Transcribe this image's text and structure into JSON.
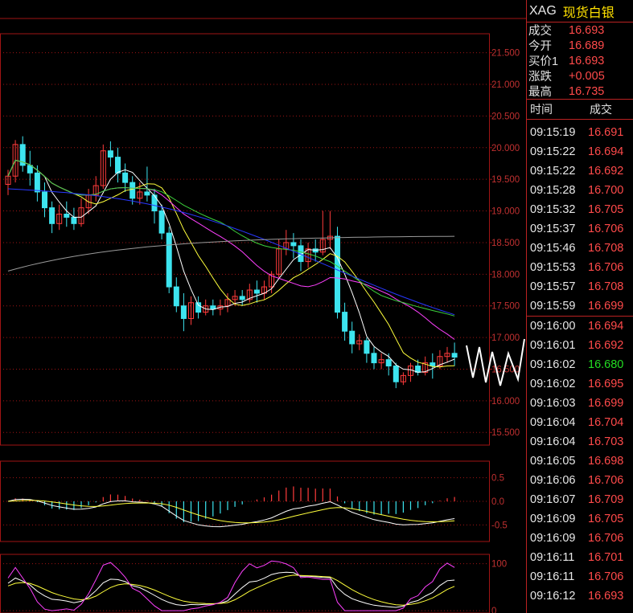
{
  "header": {
    "code": "XAG",
    "name": "现货白银"
  },
  "quote": [
    {
      "label": "成交",
      "value": "16.693"
    },
    {
      "label": "今开",
      "value": "16.689"
    },
    {
      "label": "买价1",
      "value": "16.693"
    },
    {
      "label": "涨跌",
      "value": "+0.005"
    },
    {
      "label": "最高",
      "value": "16.735"
    }
  ],
  "ticks_header": {
    "time": "时间",
    "price": "成交"
  },
  "ticks": [
    {
      "time": "09:15:19",
      "price": "16.691",
      "dir": "up"
    },
    {
      "time": "09:15:22",
      "price": "16.694",
      "dir": "up"
    },
    {
      "time": "09:15:22",
      "price": "16.692",
      "dir": "up"
    },
    {
      "time": "09:15:28",
      "price": "16.700",
      "dir": "up"
    },
    {
      "time": "09:15:32",
      "price": "16.705",
      "dir": "up"
    },
    {
      "time": "09:15:37",
      "price": "16.706",
      "dir": "up"
    },
    {
      "time": "09:15:46",
      "price": "16.708",
      "dir": "up"
    },
    {
      "time": "09:15:53",
      "price": "16.706",
      "dir": "up"
    },
    {
      "time": "09:15:57",
      "price": "16.708",
      "dir": "up"
    },
    {
      "time": "09:15:59",
      "price": "16.699",
      "dir": "up"
    },
    {
      "time": "09:16:00",
      "price": "16.694",
      "dir": "up"
    },
    {
      "time": "09:16:01",
      "price": "16.692",
      "dir": "up"
    },
    {
      "time": "09:16:02",
      "price": "16.680",
      "dir": "down"
    },
    {
      "time": "09:16:02",
      "price": "16.695",
      "dir": "up"
    },
    {
      "time": "09:16:03",
      "price": "16.699",
      "dir": "up"
    },
    {
      "time": "09:16:04",
      "price": "16.704",
      "dir": "up"
    },
    {
      "time": "09:16:04",
      "price": "16.703",
      "dir": "up"
    },
    {
      "time": "09:16:05",
      "price": "16.698",
      "dir": "up"
    },
    {
      "time": "09:16:06",
      "price": "16.706",
      "dir": "up"
    },
    {
      "time": "09:16:07",
      "price": "16.709",
      "dir": "up"
    },
    {
      "time": "09:16:09",
      "price": "16.705",
      "dir": "up"
    },
    {
      "time": "09:16:09",
      "price": "16.706",
      "dir": "up"
    },
    {
      "time": "09:16:11",
      "price": "16.701",
      "dir": "up"
    },
    {
      "time": "09:16:11",
      "price": "16.706",
      "dir": "up"
    },
    {
      "time": "09:16:12",
      "price": "16.693",
      "dir": "up"
    }
  ],
  "chart_data": [
    {
      "type": "candlestick",
      "title": "",
      "y_ticks": [
        "21.500",
        "21.000",
        "20.500",
        "20.000",
        "19.500",
        "19.000",
        "18.500",
        "18.000",
        "17.500",
        "17.000",
        "16.500",
        "16.000",
        "15.500"
      ],
      "ylim": [
        15.3,
        21.8
      ],
      "candles": [
        [
          19.42,
          19.55,
          19.25,
          19.65
        ],
        [
          19.55,
          20.05,
          19.45,
          20.12
        ],
        [
          20.05,
          19.72,
          19.62,
          20.18
        ],
        [
          19.72,
          19.6,
          19.4,
          19.95
        ],
        [
          19.6,
          19.3,
          19.15,
          19.72
        ],
        [
          19.3,
          19.05,
          18.9,
          19.45
        ],
        [
          19.05,
          18.8,
          18.65,
          19.15
        ],
        [
          18.8,
          18.95,
          18.7,
          19.1
        ],
        [
          18.95,
          18.9,
          18.75,
          19.15
        ],
        [
          18.9,
          18.8,
          18.7,
          19.05
        ],
        [
          18.8,
          19.05,
          18.75,
          19.2
        ],
        [
          19.05,
          19.25,
          18.95,
          19.35
        ],
        [
          19.25,
          19.4,
          19.15,
          19.55
        ],
        [
          19.4,
          19.95,
          19.35,
          20.05
        ],
        [
          19.95,
          19.85,
          19.7,
          20.1
        ],
        [
          19.85,
          19.6,
          19.45,
          20.0
        ],
        [
          19.6,
          19.45,
          19.3,
          19.75
        ],
        [
          19.45,
          19.2,
          19.1,
          19.55
        ],
        [
          19.2,
          19.3,
          19.1,
          19.45
        ],
        [
          19.3,
          19.25,
          19.15,
          19.7
        ],
        [
          19.25,
          19.0,
          18.8,
          19.35
        ],
        [
          19.0,
          18.65,
          18.55,
          19.1
        ],
        [
          18.65,
          17.8,
          17.7,
          18.75
        ],
        [
          17.8,
          17.5,
          17.4,
          17.95
        ],
        [
          17.5,
          17.3,
          17.1,
          17.7
        ],
        [
          17.3,
          17.55,
          17.2,
          17.65
        ],
        [
          17.55,
          17.4,
          17.3,
          17.65
        ],
        [
          17.4,
          17.5,
          17.35,
          17.6
        ],
        [
          17.5,
          17.45,
          17.35,
          17.6
        ],
        [
          17.45,
          17.5,
          17.35,
          17.6
        ],
        [
          17.5,
          17.6,
          17.4,
          17.7
        ],
        [
          17.6,
          17.65,
          17.5,
          17.75
        ],
        [
          17.65,
          17.6,
          17.5,
          17.75
        ],
        [
          17.6,
          17.75,
          17.55,
          17.85
        ],
        [
          17.75,
          17.7,
          17.55,
          17.9
        ],
        [
          17.7,
          17.8,
          17.6,
          17.9
        ],
        [
          17.8,
          18.0,
          17.7,
          18.05
        ],
        [
          18.0,
          18.4,
          17.95,
          18.55
        ],
        [
          18.4,
          18.5,
          18.3,
          18.7
        ],
        [
          18.5,
          18.45,
          18.25,
          18.65
        ],
        [
          18.45,
          18.2,
          18.05,
          18.55
        ],
        [
          18.2,
          18.4,
          18.1,
          18.5
        ],
        [
          18.4,
          18.35,
          18.2,
          18.55
        ],
        [
          18.35,
          18.55,
          18.3,
          19.0
        ],
        [
          18.55,
          18.6,
          18.4,
          19.0
        ],
        [
          18.6,
          17.4,
          17.3,
          18.75
        ],
        [
          17.4,
          17.1,
          16.95,
          17.55
        ],
        [
          17.1,
          16.9,
          16.75,
          17.25
        ],
        [
          16.9,
          16.95,
          16.8,
          17.05
        ],
        [
          16.95,
          16.75,
          16.6,
          17.0
        ],
        [
          16.75,
          16.6,
          16.5,
          16.85
        ],
        [
          16.6,
          16.65,
          16.5,
          16.75
        ],
        [
          16.65,
          16.55,
          16.4,
          16.75
        ],
        [
          16.55,
          16.3,
          16.2,
          16.6
        ],
        [
          16.3,
          16.4,
          16.25,
          16.45
        ],
        [
          16.4,
          16.55,
          16.3,
          16.6
        ],
        [
          16.55,
          16.45,
          16.4,
          16.65
        ],
        [
          16.45,
          16.6,
          16.4,
          16.7
        ],
        [
          16.6,
          16.55,
          16.35,
          16.75
        ],
        [
          16.55,
          16.7,
          16.5,
          16.8
        ],
        [
          16.7,
          16.75,
          16.6,
          16.85
        ],
        [
          16.75,
          16.69,
          16.55,
          16.92
        ]
      ]
    },
    {
      "type": "bar",
      "title": "",
      "y_ticks": [
        "0.5",
        "0.0",
        "-0.5"
      ],
      "ylim": [
        -0.85,
        0.85
      ]
    },
    {
      "type": "line",
      "title": "",
      "y_ticks": [
        "100",
        "0"
      ],
      "ylim": [
        -5,
        120
      ]
    }
  ],
  "colors": {
    "up": "#ff3b3b",
    "down": "#3de4ef",
    "grid": "#a01414",
    "ma5": "#ffffff",
    "ma10": "#ffff3c",
    "ma20": "#ff40ff",
    "ma30": "#3cd23c",
    "ma60": "#2838ff",
    "ma120": "#9a9a9a"
  }
}
